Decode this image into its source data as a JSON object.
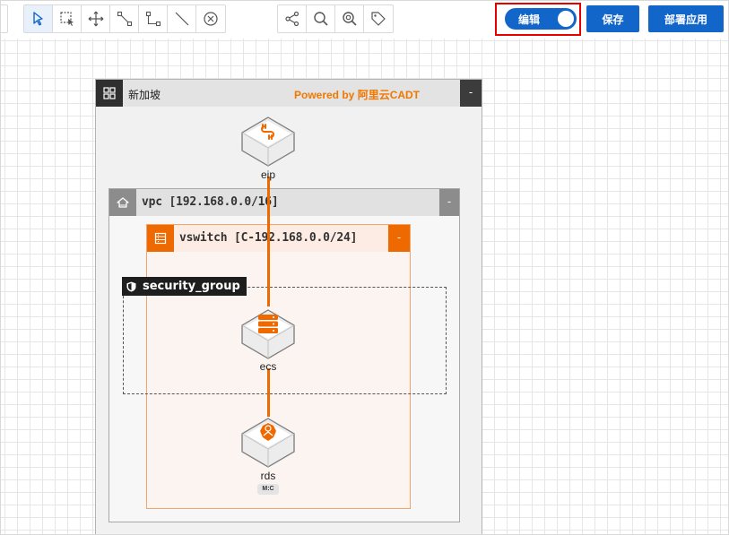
{
  "toolbar": {
    "tools": [
      {
        "icon": "pointer-icon",
        "active": true
      },
      {
        "icon": "marquee-select-icon",
        "active": false
      },
      {
        "icon": "move-icon",
        "active": false
      },
      {
        "icon": "connector-icon",
        "active": false
      },
      {
        "icon": "elbow-line-icon",
        "active": false
      },
      {
        "icon": "line-icon",
        "active": false
      },
      {
        "icon": "delete-icon",
        "active": false
      }
    ],
    "tools2": [
      {
        "icon": "share-icon"
      },
      {
        "icon": "zoom-icon"
      },
      {
        "icon": "zoom-fit-icon"
      },
      {
        "icon": "tag-icon"
      }
    ],
    "edit_label": "编辑",
    "edit_on": true,
    "save_label": "保存",
    "deploy_label": "部署应用"
  },
  "region": {
    "title": "新加坡",
    "powered_by": "Powered by 阿里云CADT",
    "collapse": "-"
  },
  "vpc": {
    "title": "vpc [192.168.0.0/16]",
    "collapse": "-"
  },
  "vswitch": {
    "title": "vswitch [C-192.168.0.0/24]",
    "collapse": "-"
  },
  "security_group": {
    "title": "security_group"
  },
  "nodes": {
    "eip": {
      "label": "eip",
      "icon": "eip-icon"
    },
    "ecs": {
      "label": "ecs",
      "icon": "ecs-server-icon"
    },
    "rds": {
      "label": "rds",
      "icon": "rds-database-icon",
      "badge": "M:C"
    }
  },
  "colors": {
    "primary": "#1366c9",
    "accent": "#ee6a00",
    "highlight": "#e60000"
  }
}
